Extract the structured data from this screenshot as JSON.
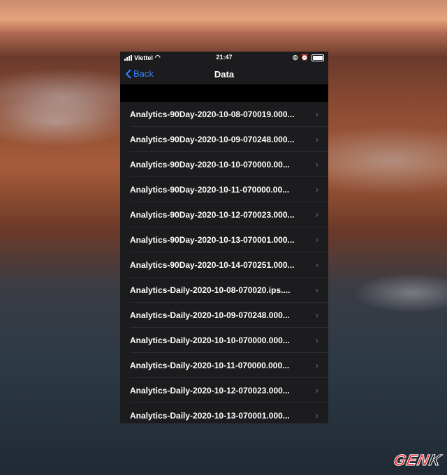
{
  "status_bar": {
    "carrier": "Viettel",
    "time": "21:47"
  },
  "nav": {
    "back_label": "Back",
    "title": "Data"
  },
  "files": [
    "Analytics-90Day-2020-10-08-070019.000...",
    "Analytics-90Day-2020-10-09-070248.000...",
    "Analytics-90Day-2020-10-10-070000.00...",
    "Analytics-90Day-2020-10-11-070000.00...",
    "Analytics-90Day-2020-10-12-070023.000...",
    "Analytics-90Day-2020-10-13-070001.000...",
    "Analytics-90Day-2020-10-14-070251.000...",
    "Analytics-Daily-2020-10-08-070020.ips....",
    "Analytics-Daily-2020-10-09-070248.000...",
    "Analytics-Daily-2020-10-10-070000.000...",
    "Analytics-Daily-2020-10-11-070000.000...",
    "Analytics-Daily-2020-10-12-070023.000...",
    "Analytics-Daily-2020-10-13-070001.000..."
  ],
  "watermark": {
    "text": "GENK",
    "part1": "GEN",
    "part2": "K"
  },
  "colors": {
    "accent": "#2f84ff",
    "background": "#1c1c1e"
  }
}
